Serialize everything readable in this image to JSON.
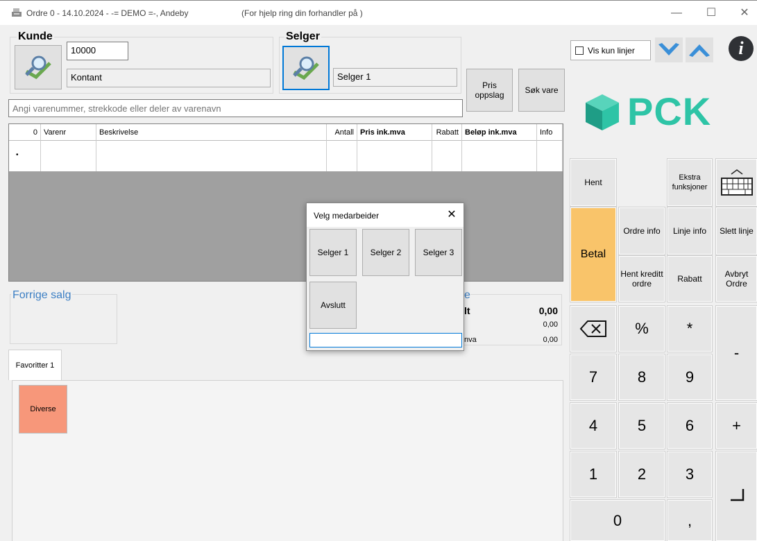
{
  "window": {
    "title": "Ordre 0 - 14.10.2024 - -= DEMO =-, Andeby",
    "help_text": "(For hjelp ring din forhandler  på )",
    "minimize": "—",
    "maximize": "☐",
    "close": "✕"
  },
  "customer": {
    "label": "Kunde",
    "number": "10000",
    "name": "Kontant"
  },
  "seller": {
    "label": "Selger",
    "name": "Selger 1"
  },
  "buttons": {
    "price_lookup": "Pris oppslag",
    "search_item": "Søk vare"
  },
  "item_input": {
    "placeholder": "Angi varenummer, strekkode eller deler av varenavn"
  },
  "grid": {
    "columns": [
      "0",
      "Varenr",
      "Beskrivelse",
      "Antall",
      "Pris ink.mva",
      "Rabatt",
      "Beløp ink.mva",
      "Info"
    ],
    "row_marker": "•"
  },
  "previous_sale": {
    "label": "Forrige salg"
  },
  "totals": {
    "label_fragment": "e",
    "total_label": "lt",
    "total_value": "0,00",
    "row2_value": "0,00",
    "row3_label": "nva",
    "row3_value": "0,00"
  },
  "favorites": {
    "tab": "Favoritter 1",
    "items": [
      "Diverse"
    ],
    "item_color": "#f7977a"
  },
  "top_right": {
    "show_lines_label": "Vis kun linjer",
    "brand": "PCK",
    "brand_color": "#2ec4a6"
  },
  "keypad": {
    "hent": "Hent",
    "ekstra": "Ekstra funksjoner",
    "betal": "Betal",
    "betal_color": "#f9c46a",
    "ordre_info": "Ordre info",
    "linje_info": "Linje info",
    "slett_linje": "Slett linje",
    "hent_kreditt": "Hent kreditt ordre",
    "rabatt": "Rabatt",
    "avbryt": "Avbryt Ordre",
    "percent": "%",
    "star": "*",
    "minus": "-",
    "plus": "+",
    "comma": ",",
    "digits": [
      "7",
      "8",
      "9",
      "4",
      "5",
      "6",
      "1",
      "2",
      "3",
      "0"
    ]
  },
  "dialog": {
    "title": "Velg medarbeider",
    "close": "✕",
    "sellers": [
      "Selger 1",
      "Selger 2",
      "Selger 3"
    ],
    "finish": "Avslutt",
    "input_value": ""
  }
}
